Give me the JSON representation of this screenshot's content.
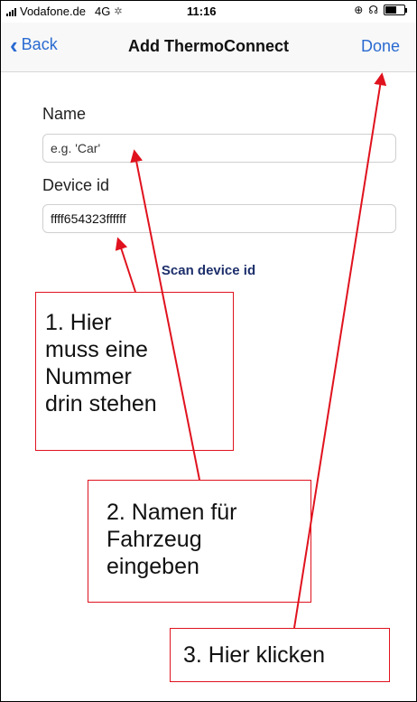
{
  "status_bar": {
    "carrier": "Vodafone.de",
    "network": "4G",
    "time": "11:16"
  },
  "nav": {
    "back_label": "Back",
    "title": "Add ThermoConnect",
    "done_label": "Done"
  },
  "form": {
    "name_label": "Name",
    "name_placeholder": "e.g. 'Car'",
    "device_id_label": "Device id",
    "device_id_value": "ffff654323ffffff",
    "scan_label": "Scan device id"
  },
  "annotations": [
    {
      "text": "1. Hier\nmuss eine\nNummer\ndrin stehen"
    },
    {
      "text": "2. Namen für\nFahrzeug\neingeben"
    },
    {
      "text": "3. Hier klicken"
    }
  ],
  "colors": {
    "accent": "#2a6ad1",
    "annotation": "#e0121e",
    "scan_text": "#1d2f6b"
  }
}
